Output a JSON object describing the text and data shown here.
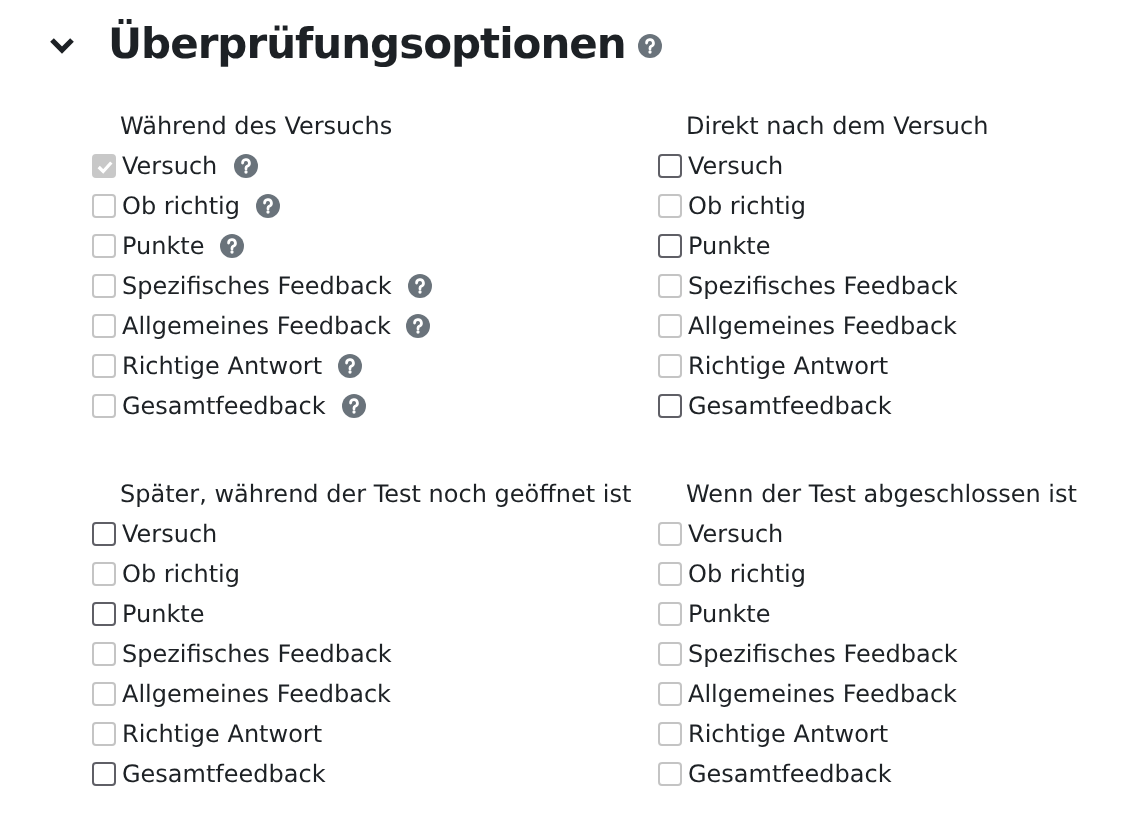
{
  "section": {
    "title": "Überprüfungsoptionen",
    "expanded": true,
    "help": true
  },
  "groups": [
    {
      "title": "Während des Versuchs",
      "options": [
        {
          "label": "Versuch",
          "checked": true,
          "disabled": true,
          "help": true
        },
        {
          "label": "Ob richtig",
          "checked": false,
          "disabled": true,
          "help": true
        },
        {
          "label": "Punkte",
          "checked": false,
          "disabled": true,
          "help": true
        },
        {
          "label": "Spezifisches Feedback",
          "checked": false,
          "disabled": true,
          "help": true
        },
        {
          "label": "Allgemeines Feedback",
          "checked": false,
          "disabled": true,
          "help": true
        },
        {
          "label": "Richtige Antwort",
          "checked": false,
          "disabled": true,
          "help": true
        },
        {
          "label": "Gesamtfeedback",
          "checked": false,
          "disabled": true,
          "help": true
        }
      ]
    },
    {
      "title": "Direkt nach dem Versuch",
      "options": [
        {
          "label": "Versuch",
          "checked": false,
          "disabled": false,
          "help": false
        },
        {
          "label": "Ob richtig",
          "checked": false,
          "disabled": true,
          "help": false
        },
        {
          "label": "Punkte",
          "checked": false,
          "disabled": false,
          "help": false
        },
        {
          "label": "Spezifisches Feedback",
          "checked": false,
          "disabled": true,
          "help": false
        },
        {
          "label": "Allgemeines Feedback",
          "checked": false,
          "disabled": true,
          "help": false
        },
        {
          "label": "Richtige Antwort",
          "checked": false,
          "disabled": true,
          "help": false
        },
        {
          "label": "Gesamtfeedback",
          "checked": false,
          "disabled": false,
          "help": false
        }
      ]
    },
    {
      "title": "Später, während der Test noch geöffnet ist",
      "options": [
        {
          "label": "Versuch",
          "checked": false,
          "disabled": false,
          "help": false
        },
        {
          "label": "Ob richtig",
          "checked": false,
          "disabled": true,
          "help": false
        },
        {
          "label": "Punkte",
          "checked": false,
          "disabled": false,
          "help": false
        },
        {
          "label": "Spezifisches Feedback",
          "checked": false,
          "disabled": true,
          "help": false
        },
        {
          "label": "Allgemeines Feedback",
          "checked": false,
          "disabled": true,
          "help": false
        },
        {
          "label": "Richtige Antwort",
          "checked": false,
          "disabled": true,
          "help": false
        },
        {
          "label": "Gesamtfeedback",
          "checked": false,
          "disabled": false,
          "help": false
        }
      ]
    },
    {
      "title": "Wenn der Test abgeschlossen ist",
      "options": [
        {
          "label": "Versuch",
          "checked": false,
          "disabled": true,
          "help": false
        },
        {
          "label": "Ob richtig",
          "checked": false,
          "disabled": true,
          "help": false
        },
        {
          "label": "Punkte",
          "checked": false,
          "disabled": true,
          "help": false
        },
        {
          "label": "Spezifisches Feedback",
          "checked": false,
          "disabled": true,
          "help": false
        },
        {
          "label": "Allgemeines Feedback",
          "checked": false,
          "disabled": true,
          "help": false
        },
        {
          "label": "Richtige Antwort",
          "checked": false,
          "disabled": true,
          "help": false
        },
        {
          "label": "Gesamtfeedback",
          "checked": false,
          "disabled": true,
          "help": false
        }
      ]
    }
  ]
}
